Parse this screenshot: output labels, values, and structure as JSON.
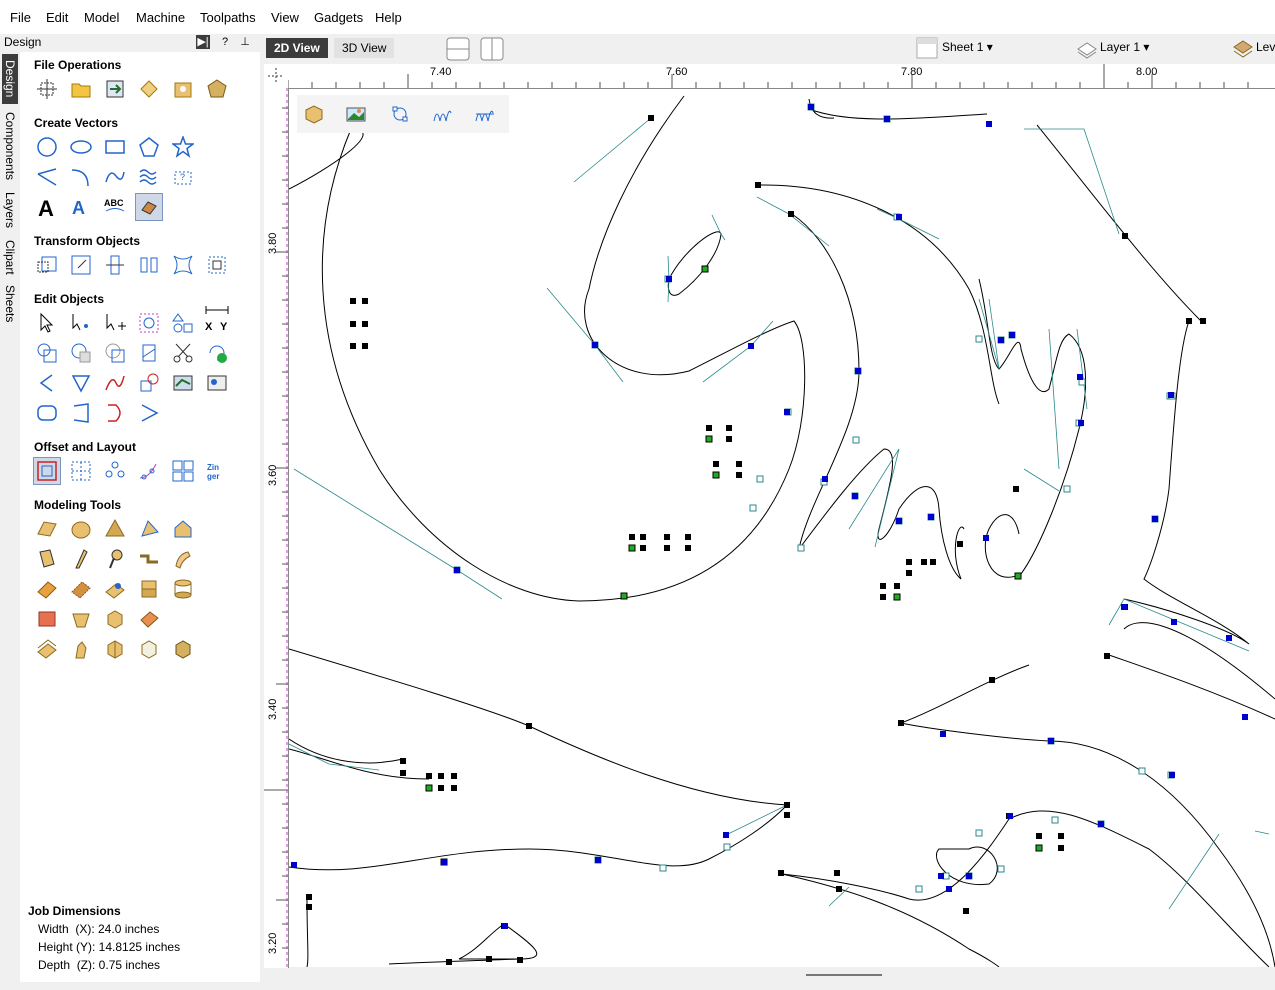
{
  "menu": [
    "File",
    "Edit",
    "Model",
    "Machine",
    "Toolpaths",
    "View",
    "Gadgets",
    "Help"
  ],
  "panel": {
    "title": "Design",
    "header_buttons": [
      "▶|",
      "?",
      "⊥"
    ],
    "tabs": [
      "Design",
      "Components",
      "Layers",
      "Clipart",
      "Sheets"
    ],
    "sections": [
      "File Operations",
      "Create Vectors",
      "Transform Objects",
      "Edit Objects",
      "Offset and Layout",
      "Modeling Tools"
    ]
  },
  "job": {
    "title": "Job Dimensions",
    "width": "Width  (X): 24.0 inches",
    "height": "Height (Y): 14.8125 inches",
    "depth": "Depth  (Z): 0.75 inches"
  },
  "view_tabs": {
    "two_d": "2D View",
    "three_d": "3D View"
  },
  "sheet_label": "Sheet 1",
  "layer_label": "Layer 1",
  "level_label": "Lev",
  "ruler": {
    "top": [
      "7.40",
      "7.60",
      "7.80",
      "8.00"
    ],
    "left": [
      "3.80",
      "3.60",
      "3.40",
      "3.20"
    ]
  },
  "colors": {
    "accent": "#3c3c3c",
    "node_blue": "#0000cc",
    "node_green": "#22aa22",
    "node_black": "#000000",
    "handle": "#2a8a8a"
  }
}
